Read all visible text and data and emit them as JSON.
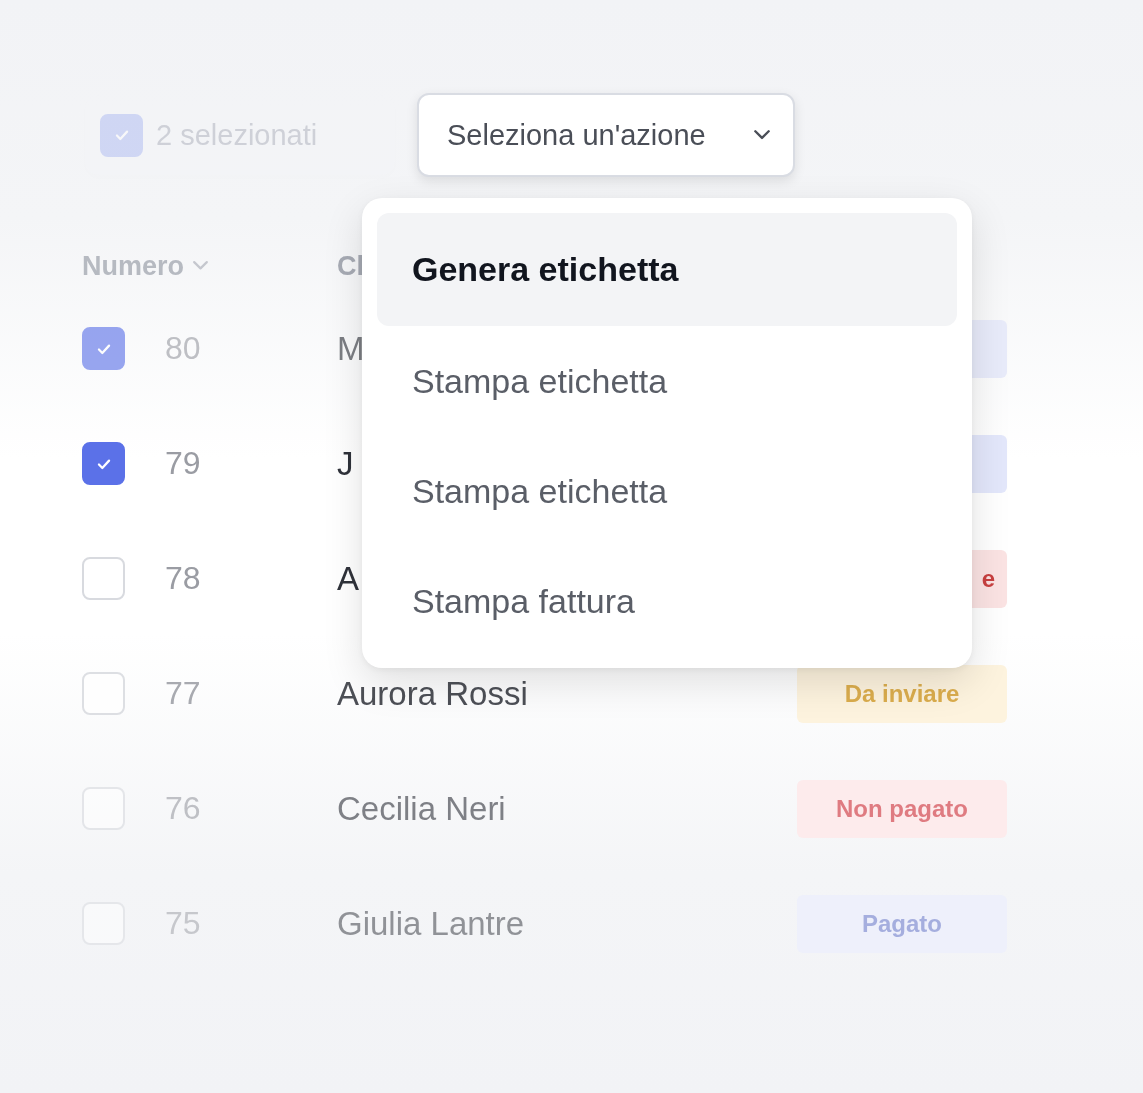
{
  "toolbar": {
    "selection": {
      "label": "2 selezionati",
      "checked": true
    },
    "action_dropdown": {
      "label": "Seleziona un'azione",
      "expanded": true
    }
  },
  "table": {
    "columns": [
      {
        "label": "Numero",
        "sortable": true
      },
      {
        "label": "Cl",
        "sortable": false
      }
    ],
    "rows": [
      {
        "number": "80",
        "name": "M",
        "checked": true,
        "status": {
          "color": "#e8ebfa"
        }
      },
      {
        "number": "79",
        "name": "J",
        "checked": true,
        "status": {
          "color": "#e3e7fb"
        }
      },
      {
        "number": "78",
        "name": "A",
        "checked": false,
        "status": {
          "text": "e",
          "color": "#fbe3e3",
          "clipped": true
        }
      },
      {
        "number": "77",
        "name": "Aurora Rossi",
        "checked": false,
        "status": {
          "text": "Da inviare",
          "color": "#fdf3de"
        }
      },
      {
        "number": "76",
        "name": "Cecilia Neri",
        "checked": false,
        "status": {
          "text": "Non pagato",
          "color": "#fdebec"
        }
      },
      {
        "number": "75",
        "name": "Giulia Lantre",
        "checked": false,
        "status": {
          "text": "Pagato",
          "color": "#eef0fb"
        }
      }
    ]
  },
  "action_menu": {
    "items": [
      {
        "label": "Genera etichetta",
        "selected": true
      },
      {
        "label": "Stampa etichetta",
        "selected": false
      },
      {
        "label": "Stampa etichetta",
        "selected": false
      },
      {
        "label": "Stampa fattura",
        "selected": false
      }
    ]
  }
}
